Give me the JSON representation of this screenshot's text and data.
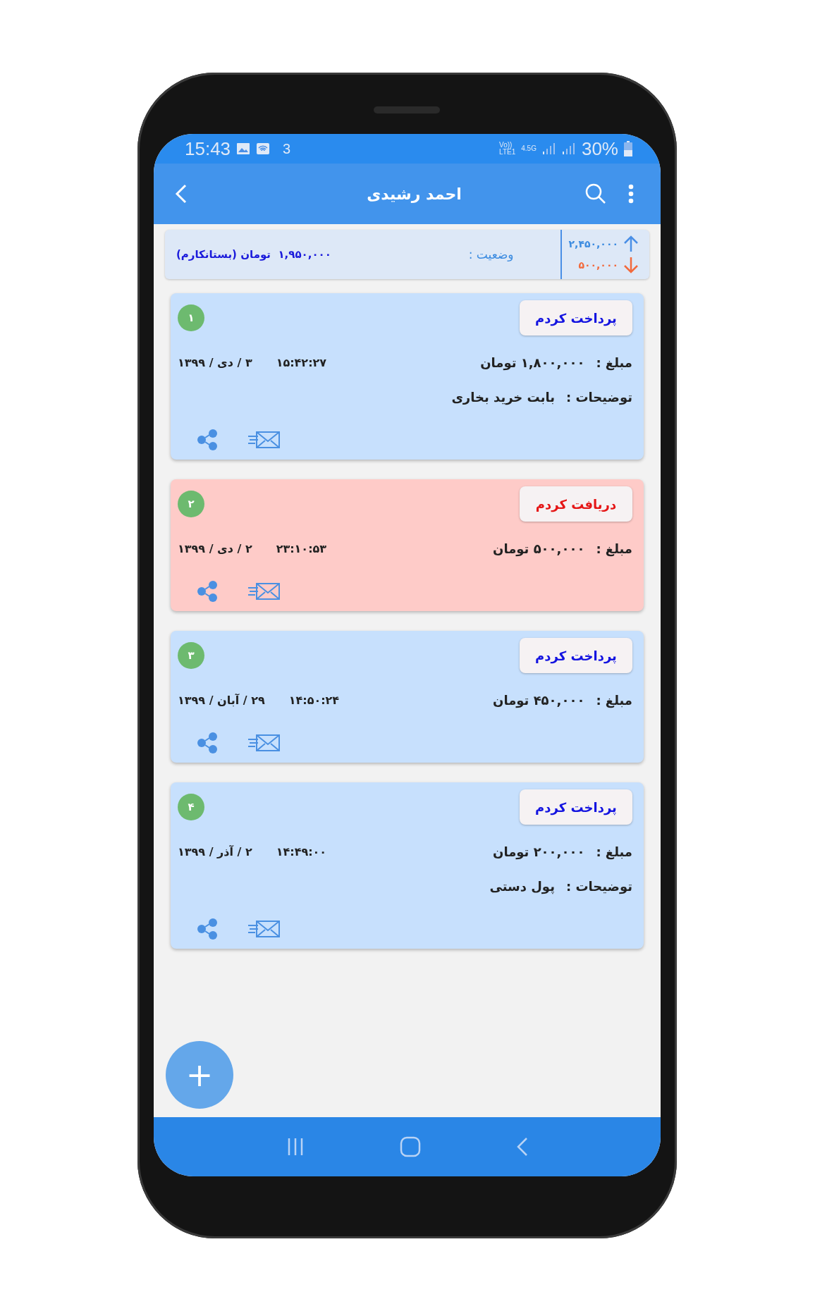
{
  "status_bar": {
    "time": "15:43",
    "notification_count": "3",
    "volte": "Vo))",
    "lte": "LTE1",
    "network": "4.5G",
    "battery": "30%"
  },
  "app_bar": {
    "title": "احمد رشیدی"
  },
  "summary": {
    "status_label": "وضعیت :",
    "status_value": "۱,۹۵۰,۰۰۰  تومان (بستانکارم)",
    "total_paid": "۲,۴۵۰,۰۰۰",
    "total_received": "۵۰۰,۰۰۰"
  },
  "transactions": [
    {
      "kind": "paid",
      "index": "۱",
      "action": "پرداخت کردم",
      "amount_label": "مبلغ :",
      "amount": "۱,۸۰۰,۰۰۰ تومان",
      "time": "۱۵:۴۲:۲۷",
      "date": "۳ / دی / ۱۳۹۹",
      "description_label": "توضیحات :",
      "description": "بابت خرید بخاری"
    },
    {
      "kind": "received",
      "index": "۲",
      "action": "دریافت کردم",
      "amount_label": "مبلغ :",
      "amount": "۵۰۰,۰۰۰ تومان",
      "time": "۲۳:۱۰:۵۳",
      "date": "۲ / دی / ۱۳۹۹"
    },
    {
      "kind": "paid",
      "index": "۳",
      "action": "پرداخت کردم",
      "amount_label": "مبلغ :",
      "amount": "۴۵۰,۰۰۰ تومان",
      "time": "۱۴:۵۰:۲۴",
      "date": "۲۹ / آبان / ۱۳۹۹"
    },
    {
      "kind": "paid",
      "index": "۴",
      "action": "پرداخت کردم",
      "amount_label": "مبلغ :",
      "amount": "۲۰۰,۰۰۰ تومان",
      "time": "۱۴:۴۹:۰۰",
      "date": "۲ / آذر / ۱۳۹۹",
      "description_label": "توضیحات :",
      "description": "پول دستی"
    }
  ],
  "fab": {
    "label": "+"
  }
}
